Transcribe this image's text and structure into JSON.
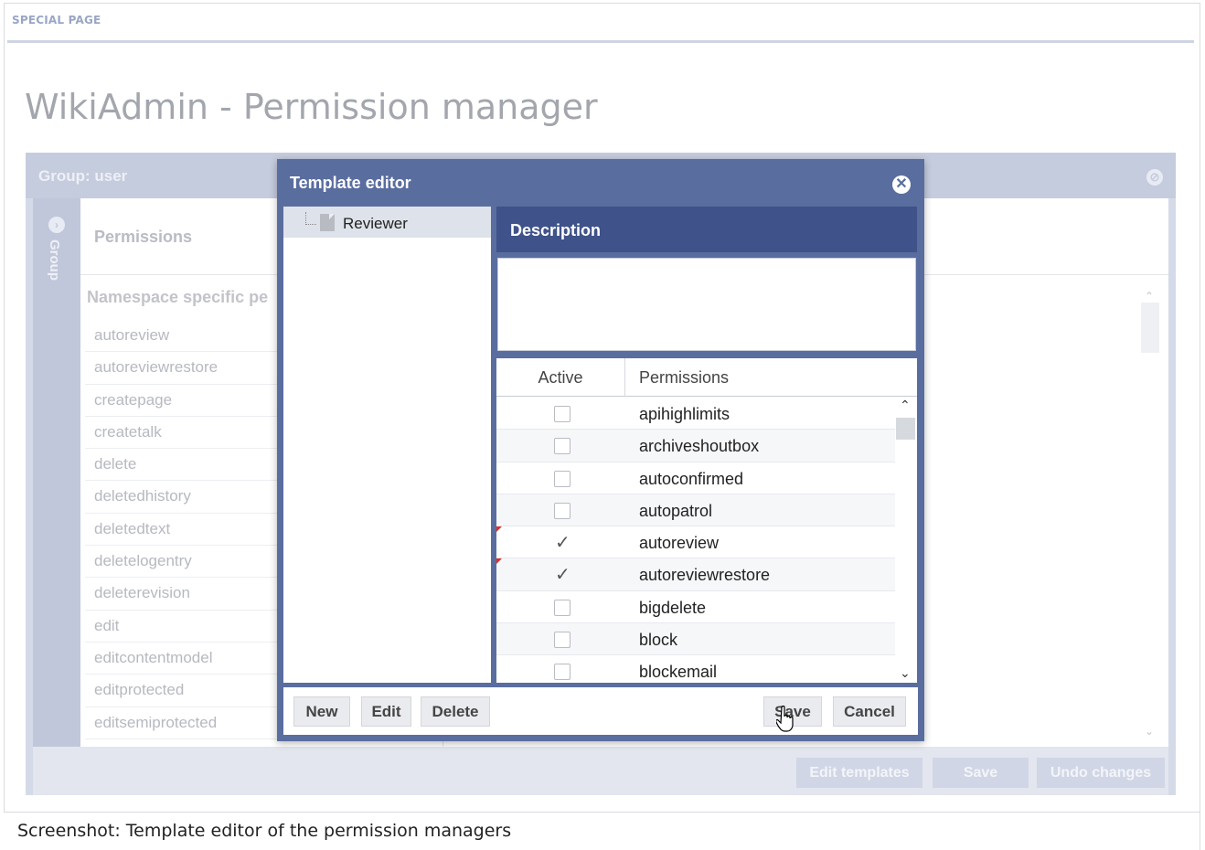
{
  "page": {
    "special_label": "SPECIAL PAGE",
    "title": "WikiAdmin - Permission manager",
    "caption": "Screenshot: Template editor of the permission managers"
  },
  "background": {
    "group_title": "Group: user",
    "side_label": "Group",
    "permissions_label": "Permissions",
    "namespace_label": "Namespace specific pe",
    "permissions": [
      "autoreview",
      "autoreviewrestore",
      "createpage",
      "createtalk",
      "delete",
      "deletedhistory",
      "deletedtext",
      "deletelogentry",
      "deleterevision",
      "edit",
      "editcontentmodel",
      "editprotected",
      "editsemiprotected"
    ],
    "buttons": {
      "edit_templates": "Edit templates",
      "save": "Save",
      "undo_changes": "Undo changes"
    }
  },
  "modal": {
    "title": "Template editor",
    "close_icon": "close-icon",
    "tree": {
      "items": [
        {
          "label": "Reviewer",
          "icon": "file-icon",
          "selected": true
        }
      ]
    },
    "description": {
      "title": "Description",
      "value": ""
    },
    "grid": {
      "col_active": "Active",
      "col_permissions": "Permissions",
      "rows": [
        {
          "name": "apihighlimits",
          "active": false,
          "dirty": false
        },
        {
          "name": "archiveshoutbox",
          "active": false,
          "dirty": false
        },
        {
          "name": "autoconfirmed",
          "active": false,
          "dirty": false
        },
        {
          "name": "autopatrol",
          "active": false,
          "dirty": false
        },
        {
          "name": "autoreview",
          "active": true,
          "dirty": true
        },
        {
          "name": "autoreviewrestore",
          "active": true,
          "dirty": true
        },
        {
          "name": "bigdelete",
          "active": false,
          "dirty": false
        },
        {
          "name": "block",
          "active": false,
          "dirty": false
        },
        {
          "name": "blockemail",
          "active": false,
          "dirty": false
        }
      ]
    },
    "buttons": {
      "new": "New",
      "edit": "Edit",
      "delete": "Delete",
      "save": "Save",
      "cancel": "Cancel"
    }
  },
  "colors": {
    "dialog_header": "#5a6d9f",
    "description_header": "#3f5289",
    "dirty_marker": "#e0302a"
  }
}
